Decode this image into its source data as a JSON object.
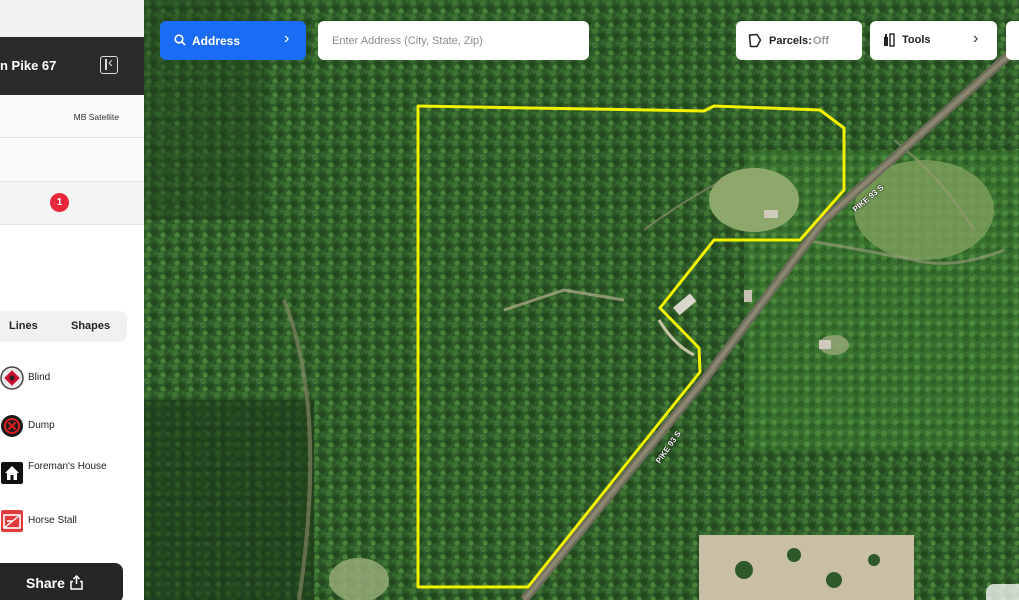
{
  "sidebar": {
    "title": "n Pike 67",
    "layer_label": "MB Satellite",
    "badge_count": "1",
    "tabs": [
      "Lines",
      "Shapes"
    ],
    "items": [
      {
        "label": "Blind",
        "icon": "blind-icon"
      },
      {
        "label": "Dump",
        "icon": "dump-icon"
      },
      {
        "label": "Foreman's House",
        "icon": "house-icon"
      },
      {
        "label": "Horse Stall",
        "icon": "horse-stall-icon"
      }
    ],
    "share_label": "Share"
  },
  "topbar": {
    "address_button": "Address",
    "address_placeholder": "Enter Address (City, State, Zip)",
    "parcels_label": "Parcels:",
    "parcels_value": "Off",
    "tools_label": "Tools"
  },
  "map": {
    "road_labels": [
      "PIKE 93 S",
      "PIKE 93 S"
    ],
    "boundary_color": "#f2f200",
    "accent_color": "#1a6cf5"
  }
}
